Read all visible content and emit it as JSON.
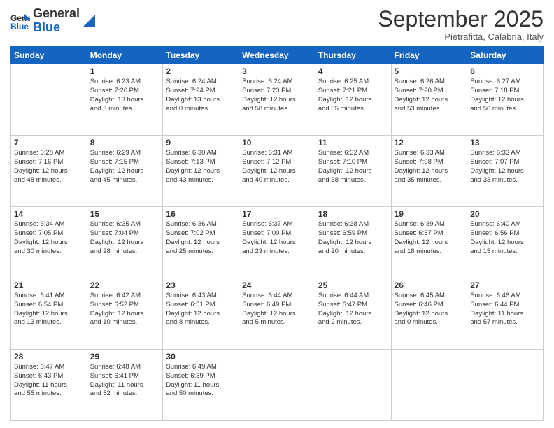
{
  "logo": {
    "general": "General",
    "blue": "Blue"
  },
  "header": {
    "month": "September 2025",
    "location": "Pietrafitta, Calabria, Italy"
  },
  "days": [
    "Sunday",
    "Monday",
    "Tuesday",
    "Wednesday",
    "Thursday",
    "Friday",
    "Saturday"
  ],
  "weeks": [
    [
      {
        "day": "",
        "lines": []
      },
      {
        "day": "1",
        "lines": [
          "Sunrise: 6:23 AM",
          "Sunset: 7:26 PM",
          "Daylight: 13 hours",
          "and 3 minutes."
        ]
      },
      {
        "day": "2",
        "lines": [
          "Sunrise: 6:24 AM",
          "Sunset: 7:24 PM",
          "Daylight: 13 hours",
          "and 0 minutes."
        ]
      },
      {
        "day": "3",
        "lines": [
          "Sunrise: 6:24 AM",
          "Sunset: 7:23 PM",
          "Daylight: 12 hours",
          "and 58 minutes."
        ]
      },
      {
        "day": "4",
        "lines": [
          "Sunrise: 6:25 AM",
          "Sunset: 7:21 PM",
          "Daylight: 12 hours",
          "and 55 minutes."
        ]
      },
      {
        "day": "5",
        "lines": [
          "Sunrise: 6:26 AM",
          "Sunset: 7:20 PM",
          "Daylight: 12 hours",
          "and 53 minutes."
        ]
      },
      {
        "day": "6",
        "lines": [
          "Sunrise: 6:27 AM",
          "Sunset: 7:18 PM",
          "Daylight: 12 hours",
          "and 50 minutes."
        ]
      }
    ],
    [
      {
        "day": "7",
        "lines": [
          "Sunrise: 6:28 AM",
          "Sunset: 7:16 PM",
          "Daylight: 12 hours",
          "and 48 minutes."
        ]
      },
      {
        "day": "8",
        "lines": [
          "Sunrise: 6:29 AM",
          "Sunset: 7:15 PM",
          "Daylight: 12 hours",
          "and 45 minutes."
        ]
      },
      {
        "day": "9",
        "lines": [
          "Sunrise: 6:30 AM",
          "Sunset: 7:13 PM",
          "Daylight: 12 hours",
          "and 43 minutes."
        ]
      },
      {
        "day": "10",
        "lines": [
          "Sunrise: 6:31 AM",
          "Sunset: 7:12 PM",
          "Daylight: 12 hours",
          "and 40 minutes."
        ]
      },
      {
        "day": "11",
        "lines": [
          "Sunrise: 6:32 AM",
          "Sunset: 7:10 PM",
          "Daylight: 12 hours",
          "and 38 minutes."
        ]
      },
      {
        "day": "12",
        "lines": [
          "Sunrise: 6:33 AM",
          "Sunset: 7:08 PM",
          "Daylight: 12 hours",
          "and 35 minutes."
        ]
      },
      {
        "day": "13",
        "lines": [
          "Sunrise: 6:33 AM",
          "Sunset: 7:07 PM",
          "Daylight: 12 hours",
          "and 33 minutes."
        ]
      }
    ],
    [
      {
        "day": "14",
        "lines": [
          "Sunrise: 6:34 AM",
          "Sunset: 7:05 PM",
          "Daylight: 12 hours",
          "and 30 minutes."
        ]
      },
      {
        "day": "15",
        "lines": [
          "Sunrise: 6:35 AM",
          "Sunset: 7:04 PM",
          "Daylight: 12 hours",
          "and 28 minutes."
        ]
      },
      {
        "day": "16",
        "lines": [
          "Sunrise: 6:36 AM",
          "Sunset: 7:02 PM",
          "Daylight: 12 hours",
          "and 25 minutes."
        ]
      },
      {
        "day": "17",
        "lines": [
          "Sunrise: 6:37 AM",
          "Sunset: 7:00 PM",
          "Daylight: 12 hours",
          "and 23 minutes."
        ]
      },
      {
        "day": "18",
        "lines": [
          "Sunrise: 6:38 AM",
          "Sunset: 6:59 PM",
          "Daylight: 12 hours",
          "and 20 minutes."
        ]
      },
      {
        "day": "19",
        "lines": [
          "Sunrise: 6:39 AM",
          "Sunset: 6:57 PM",
          "Daylight: 12 hours",
          "and 18 minutes."
        ]
      },
      {
        "day": "20",
        "lines": [
          "Sunrise: 6:40 AM",
          "Sunset: 6:56 PM",
          "Daylight: 12 hours",
          "and 15 minutes."
        ]
      }
    ],
    [
      {
        "day": "21",
        "lines": [
          "Sunrise: 6:41 AM",
          "Sunset: 6:54 PM",
          "Daylight: 12 hours",
          "and 13 minutes."
        ]
      },
      {
        "day": "22",
        "lines": [
          "Sunrise: 6:42 AM",
          "Sunset: 6:52 PM",
          "Daylight: 12 hours",
          "and 10 minutes."
        ]
      },
      {
        "day": "23",
        "lines": [
          "Sunrise: 6:43 AM",
          "Sunset: 6:51 PM",
          "Daylight: 12 hours",
          "and 8 minutes."
        ]
      },
      {
        "day": "24",
        "lines": [
          "Sunrise: 6:44 AM",
          "Sunset: 6:49 PM",
          "Daylight: 12 hours",
          "and 5 minutes."
        ]
      },
      {
        "day": "25",
        "lines": [
          "Sunrise: 6:44 AM",
          "Sunset: 6:47 PM",
          "Daylight: 12 hours",
          "and 2 minutes."
        ]
      },
      {
        "day": "26",
        "lines": [
          "Sunrise: 6:45 AM",
          "Sunset: 6:46 PM",
          "Daylight: 12 hours",
          "and 0 minutes."
        ]
      },
      {
        "day": "27",
        "lines": [
          "Sunrise: 6:46 AM",
          "Sunset: 6:44 PM",
          "Daylight: 11 hours",
          "and 57 minutes."
        ]
      }
    ],
    [
      {
        "day": "28",
        "lines": [
          "Sunrise: 6:47 AM",
          "Sunset: 6:43 PM",
          "Daylight: 11 hours",
          "and 55 minutes."
        ]
      },
      {
        "day": "29",
        "lines": [
          "Sunrise: 6:48 AM",
          "Sunset: 6:41 PM",
          "Daylight: 11 hours",
          "and 52 minutes."
        ]
      },
      {
        "day": "30",
        "lines": [
          "Sunrise: 6:49 AM",
          "Sunset: 6:39 PM",
          "Daylight: 11 hours",
          "and 50 minutes."
        ]
      },
      {
        "day": "",
        "lines": []
      },
      {
        "day": "",
        "lines": []
      },
      {
        "day": "",
        "lines": []
      },
      {
        "day": "",
        "lines": []
      }
    ]
  ]
}
